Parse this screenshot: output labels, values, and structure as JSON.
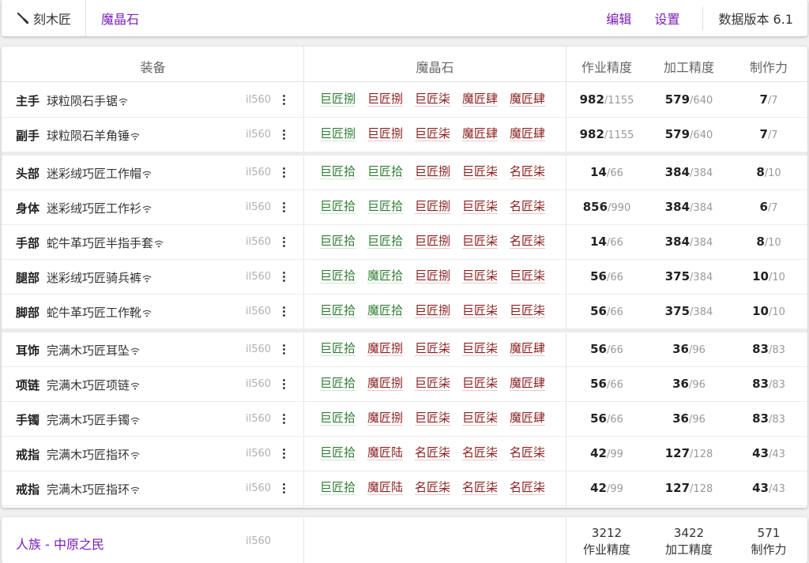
{
  "topbar": {
    "job": "刻木匠",
    "title": "魔晶石",
    "edit": "编辑",
    "settings": "设置",
    "version": "数据版本 6.1"
  },
  "columns": {
    "gear": "装备",
    "materia": "魔晶石",
    "craftsmanship": "作业精度",
    "control": "加工精度",
    "cp": "制作力"
  },
  "colors": {
    "accent": "#7a1fb8",
    "materia_green": "#2e7d32",
    "materia_red": "#8b1e1e"
  },
  "rows": [
    {
      "slot": "主手",
      "name": "球粒陨石手锯",
      "ilvl": "il560",
      "materia": [
        [
          "巨匠捌",
          "g"
        ],
        [
          "巨匠捌",
          "r"
        ],
        [
          "巨匠柒",
          "r"
        ],
        [
          "魔匠肆",
          "r"
        ],
        [
          "魔匠肆",
          "r"
        ]
      ],
      "cr": "982",
      "crMax": "/1155",
      "co": "579",
      "coMax": "/640",
      "cp": "7",
      "cpMax": "/7"
    },
    {
      "slot": "副手",
      "name": "球粒陨石羊角锤",
      "ilvl": "il560",
      "materia": [
        [
          "巨匠捌",
          "g"
        ],
        [
          "巨匠捌",
          "r"
        ],
        [
          "巨匠柒",
          "r"
        ],
        [
          "魔匠肆",
          "r"
        ],
        [
          "魔匠肆",
          "r"
        ]
      ],
      "cr": "982",
      "crMax": "/1155",
      "co": "579",
      "coMax": "/640",
      "cp": "7",
      "cpMax": "/7"
    },
    {
      "slot": "头部",
      "name": "迷彩绒巧匠工作帽",
      "ilvl": "il560",
      "materia": [
        [
          "巨匠拾",
          "g"
        ],
        [
          "巨匠拾",
          "g"
        ],
        [
          "巨匠捌",
          "r"
        ],
        [
          "巨匠柒",
          "r"
        ],
        [
          "名匠柒",
          "r"
        ]
      ],
      "cr": "14",
      "crMax": "/66",
      "co": "384",
      "coMax": "/384",
      "cp": "8",
      "cpMax": "/10"
    },
    {
      "slot": "身体",
      "name": "迷彩绒巧匠工作衫",
      "ilvl": "il560",
      "materia": [
        [
          "巨匠拾",
          "g"
        ],
        [
          "巨匠拾",
          "g"
        ],
        [
          "巨匠捌",
          "r"
        ],
        [
          "巨匠柒",
          "r"
        ],
        [
          "名匠柒",
          "r"
        ]
      ],
      "cr": "856",
      "crMax": "/990",
      "co": "384",
      "coMax": "/384",
      "cp": "6",
      "cpMax": "/7"
    },
    {
      "slot": "手部",
      "name": "蛇牛革巧匠半指手套",
      "ilvl": "il560",
      "materia": [
        [
          "巨匠拾",
          "g"
        ],
        [
          "巨匠拾",
          "g"
        ],
        [
          "巨匠捌",
          "r"
        ],
        [
          "巨匠柒",
          "r"
        ],
        [
          "名匠柒",
          "r"
        ]
      ],
      "cr": "14",
      "crMax": "/66",
      "co": "384",
      "coMax": "/384",
      "cp": "8",
      "cpMax": "/10"
    },
    {
      "slot": "腿部",
      "name": "迷彩绒巧匠骑兵裤",
      "ilvl": "il560",
      "materia": [
        [
          "巨匠拾",
          "g"
        ],
        [
          "魔匠拾",
          "g"
        ],
        [
          "巨匠捌",
          "r"
        ],
        [
          "巨匠柒",
          "r"
        ],
        [
          "巨匠柒",
          "r"
        ]
      ],
      "cr": "56",
      "crMax": "/66",
      "co": "375",
      "coMax": "/384",
      "cp": "10",
      "cpMax": "/10"
    },
    {
      "slot": "脚部",
      "name": "蛇牛革巧匠工作靴",
      "ilvl": "il560",
      "materia": [
        [
          "巨匠拾",
          "g"
        ],
        [
          "魔匠拾",
          "g"
        ],
        [
          "巨匠捌",
          "r"
        ],
        [
          "巨匠柒",
          "r"
        ],
        [
          "巨匠柒",
          "r"
        ]
      ],
      "cr": "56",
      "crMax": "/66",
      "co": "375",
      "coMax": "/384",
      "cp": "10",
      "cpMax": "/10"
    },
    {
      "slot": "耳饰",
      "name": "完满木巧匠耳坠",
      "ilvl": "il560",
      "materia": [
        [
          "巨匠拾",
          "g"
        ],
        [
          "魔匠捌",
          "r"
        ],
        [
          "巨匠柒",
          "r"
        ],
        [
          "巨匠柒",
          "r"
        ],
        [
          "魔匠肆",
          "r"
        ]
      ],
      "cr": "56",
      "crMax": "/66",
      "co": "36",
      "coMax": "/96",
      "cp": "83",
      "cpMax": "/83"
    },
    {
      "slot": "项链",
      "name": "完满木巧匠项链",
      "ilvl": "il560",
      "materia": [
        [
          "巨匠拾",
          "g"
        ],
        [
          "魔匠捌",
          "r"
        ],
        [
          "巨匠柒",
          "r"
        ],
        [
          "巨匠柒",
          "r"
        ],
        [
          "魔匠肆",
          "r"
        ]
      ],
      "cr": "56",
      "crMax": "/66",
      "co": "36",
      "coMax": "/96",
      "cp": "83",
      "cpMax": "/83"
    },
    {
      "slot": "手镯",
      "name": "完满木巧匠手镯",
      "ilvl": "il560",
      "materia": [
        [
          "巨匠拾",
          "g"
        ],
        [
          "魔匠捌",
          "r"
        ],
        [
          "巨匠柒",
          "r"
        ],
        [
          "巨匠柒",
          "r"
        ],
        [
          "魔匠肆",
          "r"
        ]
      ],
      "cr": "56",
      "crMax": "/66",
      "co": "36",
      "coMax": "/96",
      "cp": "83",
      "cpMax": "/83"
    },
    {
      "slot": "戒指",
      "name": "完满木巧匠指环",
      "ilvl": "il560",
      "materia": [
        [
          "巨匠拾",
          "g"
        ],
        [
          "魔匠陆",
          "r"
        ],
        [
          "名匠柒",
          "r"
        ],
        [
          "名匠柒",
          "r"
        ],
        [
          "名匠柒",
          "r"
        ]
      ],
      "cr": "42",
      "crMax": "/99",
      "co": "127",
      "coMax": "/128",
      "cp": "43",
      "cpMax": "/43"
    },
    {
      "slot": "戒指",
      "name": "完满木巧匠指环",
      "ilvl": "il560",
      "materia": [
        [
          "巨匠拾",
          "g"
        ],
        [
          "魔匠陆",
          "r"
        ],
        [
          "名匠柒",
          "r"
        ],
        [
          "名匠柒",
          "r"
        ],
        [
          "名匠柒",
          "r"
        ]
      ],
      "cr": "42",
      "crMax": "/99",
      "co": "127",
      "coMax": "/128",
      "cp": "43",
      "cpMax": "/43"
    }
  ],
  "footer": {
    "race": "人族 - 中原之民",
    "ilvl": "il560",
    "craftsmanship_total": "3212",
    "craftsmanship_label": "作业精度",
    "control_total": "3422",
    "control_label": "加工精度",
    "cp_total": "571",
    "cp_label": "制作力"
  }
}
